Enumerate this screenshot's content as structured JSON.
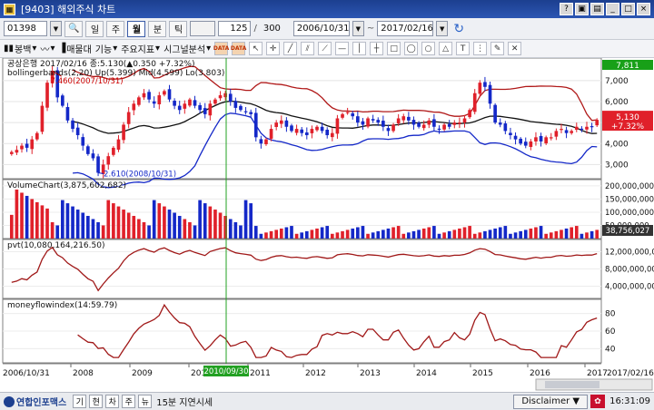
{
  "window": {
    "title": "[9403] 해외주식 차트"
  },
  "toolbar": {
    "symbol": "01398",
    "periods": [
      "일",
      "주",
      "월",
      "분",
      "틱"
    ],
    "active_period": "월",
    "count": "125",
    "count_sep": "/",
    "count_max": "300",
    "start_date": "2006/10/31",
    "range_sep": "~",
    "end_date": "2017/02/16"
  },
  "toolbar2": {
    "items": [
      "봉백",
      "매물대",
      "기능",
      "주요지표",
      "시그널분석"
    ]
  },
  "chart": {
    "colors": {
      "up": "#e0202a",
      "down": "#1428c8",
      "band": "#b01818",
      "mid": "#111111",
      "lower": "#1428c8"
    },
    "price_panel": {
      "caption": "공상은행 2017/02/16 종:5.130(▲0.350 +7.32%)",
      "indicator": "bollingerbands(2,20) Up(5.399) Mid(4.599) Lo(3.803)",
      "high_label": "7.460(2007/10/31)",
      "low_label": "2.610(2008/10/31)",
      "last_price": "5,130",
      "last_change": "+7.32%",
      "top_tag": "7,811",
      "y_range": [
        2.5,
        7.9
      ],
      "y_ticks": [
        "7,000",
        "6,000",
        "5,000",
        "4,000",
        "3,000"
      ],
      "y_tick_values": [
        7,
        6,
        5,
        4,
        3
      ]
    },
    "volume_panel": {
      "caption": "VolumeChart(3,875,602,682)",
      "last_value": "38,756,027",
      "y_ticks": [
        "200,000,000",
        "150,000,000",
        "100,000,000",
        "50,000,000"
      ],
      "y_tick_values": [
        200,
        150,
        100,
        50
      ],
      "y_max": 210
    },
    "pvt_panel": {
      "caption": "pvt(10,080,164,216.50)",
      "y_ticks": [
        "12,000,000,000",
        "8,000,000,000",
        "4,000,000,000"
      ],
      "y_tick_values": [
        12,
        8,
        4
      ],
      "y_range": [
        2,
        14
      ]
    },
    "mfi_panel": {
      "caption": "moneyflowindex(14:59.79)",
      "y_ticks": [
        "80",
        "60",
        "40"
      ],
      "y_tick_values": [
        80,
        60,
        40
      ],
      "y_range": [
        28,
        92
      ]
    },
    "x_labels": [
      "2006/10/31",
      "2008",
      "2009",
      "2010",
      "2011",
      "2012",
      "2013",
      "2014",
      "2015",
      "2016",
      "2017",
      "2017/02/16"
    ],
    "crosshair_date": "2010/09/30"
  },
  "chart_data": {
    "type": "candlestick",
    "monthly_close": [
      3.6,
      3.7,
      3.9,
      3.8,
      4.2,
      4.5,
      5.8,
      6.9,
      7.46,
      6.2,
      5.8,
      5.1,
      4.7,
      4.4,
      3.9,
      3.5,
      3.3,
      2.61,
      3.0,
      3.4,
      3.8,
      4.2,
      4.9,
      5.5,
      5.9,
      6.2,
      6.4,
      6.1,
      5.9,
      6.3,
      6.5,
      6.1,
      5.8,
      5.6,
      5.9,
      6.1,
      5.8,
      5.6,
      5.4,
      5.9,
      6.1,
      6.3,
      6.4,
      6.0,
      5.7,
      5.6,
      5.5,
      5.4,
      4.3,
      4.0,
      4.2,
      4.7,
      5.0,
      5.1,
      4.8,
      4.6,
      4.7,
      4.5,
      4.4,
      4.7,
      4.8,
      4.6,
      4.4,
      4.5,
      5.2,
      5.4,
      5.5,
      5.3,
      5.0,
      4.9,
      5.2,
      5.1,
      5.0,
      4.8,
      4.6,
      4.9,
      5.2,
      5.3,
      5.1,
      4.9,
      4.8,
      4.9,
      5.1,
      4.8,
      4.7,
      4.9,
      4.8,
      5.0,
      5.0,
      5.2,
      5.6,
      6.4,
      6.9,
      6.7,
      5.9,
      5.0,
      4.9,
      4.6,
      4.4,
      4.2,
      4.0,
      3.9,
      4.1,
      4.3,
      4.1,
      4.3,
      4.3,
      4.6,
      4.7,
      4.5,
      4.6,
      4.8,
      4.7,
      4.8,
      4.78,
      5.13
    ],
    "upper_band_last": 5.399,
    "mid_band_last": 4.599,
    "lower_band_last": 3.803
  }
}
